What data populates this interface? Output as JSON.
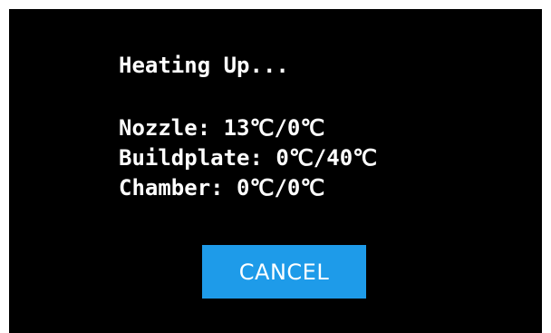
{
  "dialog": {
    "title": "Heating Up...",
    "readouts": [
      {
        "text": "Nozzle: 13℃/0℃"
      },
      {
        "text": "Buildplate: 0℃/40℃"
      },
      {
        "text": "Chamber: 0℃/0℃"
      }
    ],
    "cancel_label": "CANCEL"
  },
  "colors": {
    "background": "#000000",
    "text": "#ffffff",
    "accent": "#1e9be9",
    "frame": "#ffffff"
  }
}
